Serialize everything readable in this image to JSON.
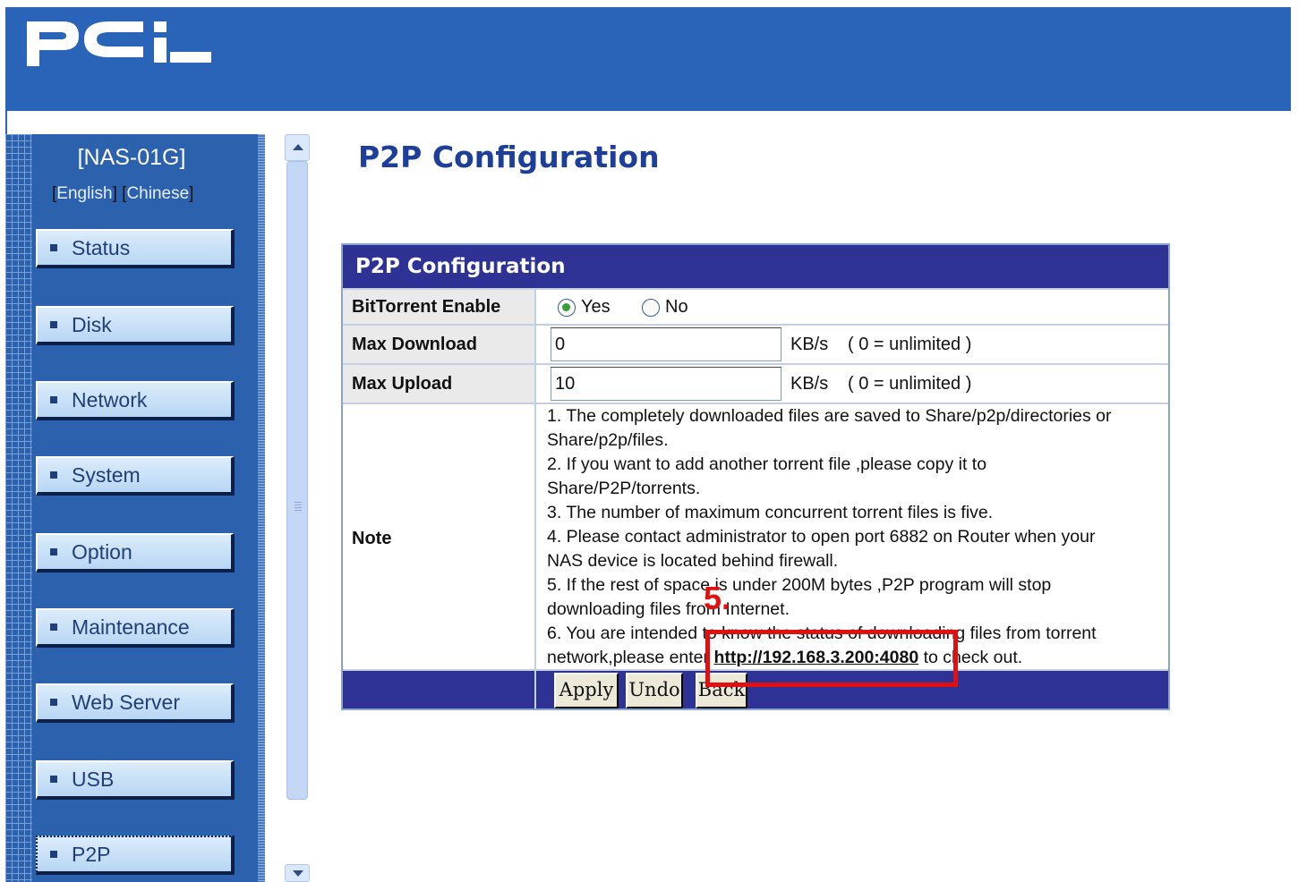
{
  "header": {
    "logo": "PCi"
  },
  "sidebar": {
    "device_name": "[NAS-01G]",
    "languages": [
      "English",
      "Chinese"
    ],
    "items": [
      {
        "label": "Status"
      },
      {
        "label": "Disk"
      },
      {
        "label": "Network"
      },
      {
        "label": "System"
      },
      {
        "label": "Option"
      },
      {
        "label": "Maintenance"
      },
      {
        "label": "Web Server"
      },
      {
        "label": "USB"
      },
      {
        "label": "P2P",
        "active": true
      }
    ]
  },
  "main": {
    "page_title": "P2P Configuration",
    "table": {
      "title": "P2P Configuration",
      "bittorrent": {
        "label": "BitTorrent Enable",
        "options": [
          "Yes",
          "No"
        ],
        "selected": "Yes"
      },
      "max_download": {
        "label": "Max Download",
        "value": "0",
        "unit": "KB/s",
        "hint": "( 0 = unlimited )"
      },
      "max_upload": {
        "label": "Max Upload",
        "value": "10",
        "unit": "KB/s",
        "hint": "( 0 = unlimited )"
      },
      "note": {
        "label": "Note",
        "lines": [
          "1. The completely downloaded files are saved to Share/p2p/directories or",
          "Share/p2p/files.",
          "2. If you want to add another torrent file ,please copy it to",
          "Share/P2P/torrents.",
          "3. The number of maximum concurrent torrent files is five.",
          "4. Please contact administrator to open port 6882 on Router when your",
          "NAS device is located behind firewall.",
          "5. If the rest of space is under 200M bytes ,P2P program will stop",
          "downloading files from Internet.",
          "6. You are intended to know the status of downloading files from torrent"
        ],
        "last_line_prefix": "network,please enter ",
        "link": "http://192.168.3.200:4080",
        "last_line_suffix": " to check out."
      },
      "buttons": {
        "apply": "Apply",
        "undo": "Undo",
        "back": "Back"
      }
    }
  },
  "annotation": {
    "label": "5.",
    "color": "#e01010"
  }
}
